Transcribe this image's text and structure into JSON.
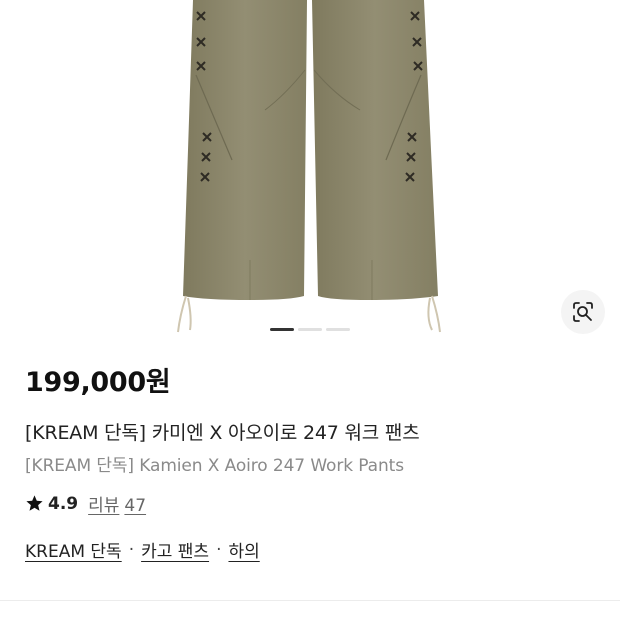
{
  "product": {
    "price": "199,000원",
    "title_ko": "[KREAM 단독] 카미엔 X 아오이로 247 워크 팬츠",
    "title_en": "[KREAM 단독] Kamien X Aoiro 247 Work Pants",
    "image_alt": "product-photo-work-pants"
  },
  "gallery": {
    "current_slide": 1,
    "total_slides": 3,
    "lens_icon": "image-search-icon",
    "pants_color": "#8f8a6e"
  },
  "rating": {
    "star_icon": "star-icon",
    "score": "4.9",
    "review_label": "리뷰",
    "review_count": "47"
  },
  "tags": [
    {
      "label": "KREAM 단독"
    },
    {
      "label": "카고 팬츠"
    },
    {
      "label": "하의"
    }
  ],
  "tag_separator": "·"
}
